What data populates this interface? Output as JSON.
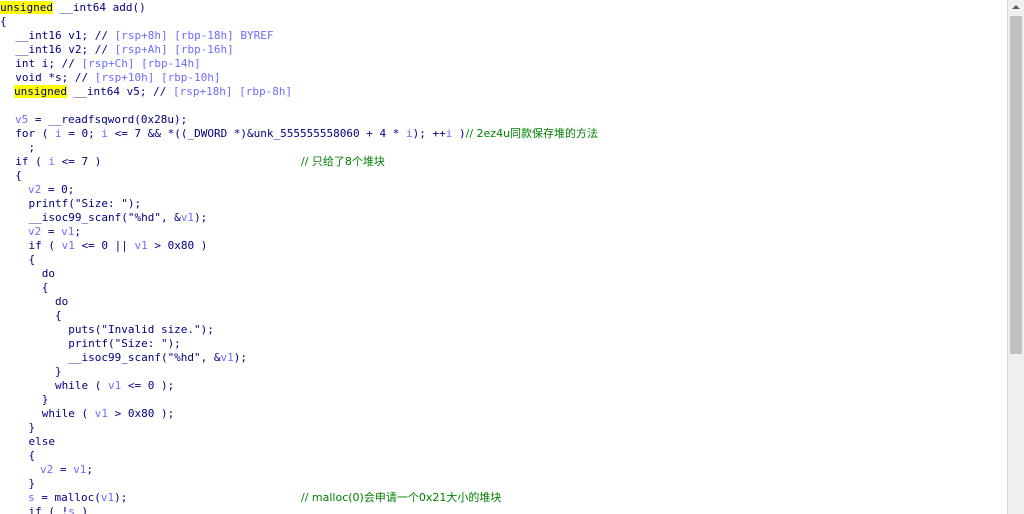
{
  "editor": {
    "l0": {
      "a": "unsigned",
      "b": " __int64 add()"
    },
    "l1": {
      "a": "{"
    },
    "l2": {
      "a": "  __int16 v1; // ",
      "b": "[rsp+8h] [rbp-18h] BYREF"
    },
    "l3": {
      "a": "  __int16 v2; // ",
      "b": "[rsp+Ah] [rbp-16h]"
    },
    "l4": {
      "a": "  int i; // ",
      "b": "[rsp+Ch] [rbp-14h]"
    },
    "l5": {
      "a": "  void *s; // ",
      "b": "[rsp+10h] [rbp-10h]"
    },
    "l6": {
      "a": "unsigned",
      "b": " __int64 v5; // ",
      "c": "[rsp+18h] [rbp-8h]"
    },
    "l8": {
      "a": "v5",
      "b": " = __readfsqword(0x28u);"
    },
    "l9": {
      "a": "  for ( ",
      "b": "i",
      "c": " = 0; ",
      "d": "i",
      "e": " <= 7 && *((_DWORD *)&unk_555555558060 + 4 * ",
      "f": "i",
      "g": "); ++",
      "h": "i",
      "i": " )",
      "j": "// 2ez4u同款保存堆的方法"
    },
    "l10": {
      "a": "    ;"
    },
    "l11": {
      "a": "  if ( ",
      "b": "i",
      "c": " <= 7 )",
      "d": "// 只给了8个堆块"
    },
    "l12": {
      "a": "  {"
    },
    "l13": {
      "a": "v2",
      "b": " = 0;"
    },
    "l14": {
      "a": "    printf(\"Size: \");"
    },
    "l15": {
      "a": "    __isoc99_scanf(\"%hd\", &",
      "b": "v1",
      "c": ");"
    },
    "l16": {
      "a": "v2",
      "b": " = ",
      "c": "v1",
      "d": ";"
    },
    "l17": {
      "a": "    if ( ",
      "b": "v1",
      "c": " <= 0 || ",
      "d": "v1",
      "e": " > 0x80 )"
    },
    "l18": {
      "a": "    {"
    },
    "l19": {
      "a": "      do"
    },
    "l20": {
      "a": "      {"
    },
    "l21": {
      "a": "        do"
    },
    "l22": {
      "a": "        {"
    },
    "l23": {
      "a": "          puts(\"Invalid size.\");"
    },
    "l24": {
      "a": "          printf(\"Size: \");"
    },
    "l25": {
      "a": "          __isoc99_scanf(\"%hd\", &",
      "b": "v1",
      "c": ");"
    },
    "l26": {
      "a": "        }"
    },
    "l27": {
      "a": "        while ( ",
      "b": "v1",
      "c": " <= 0 );"
    },
    "l28": {
      "a": "      }"
    },
    "l29": {
      "a": "      while ( ",
      "b": "v1",
      "c": " > 0x80 );"
    },
    "l30": {
      "a": "    }"
    },
    "l31": {
      "a": "    else"
    },
    "l32": {
      "a": "    {"
    },
    "l33": {
      "a": "v2",
      "b": " = ",
      "c": "v1",
      "d": ";"
    },
    "l34": {
      "a": "    }"
    },
    "l35": {
      "a": "s",
      "b": " = malloc(",
      "c": "v1",
      "d": ");",
      "e": "// malloc(0)会申请一个0x21大小的堆块"
    },
    "l36": {
      "a": "    if ( !",
      "b": "s",
      "c": " )"
    }
  }
}
